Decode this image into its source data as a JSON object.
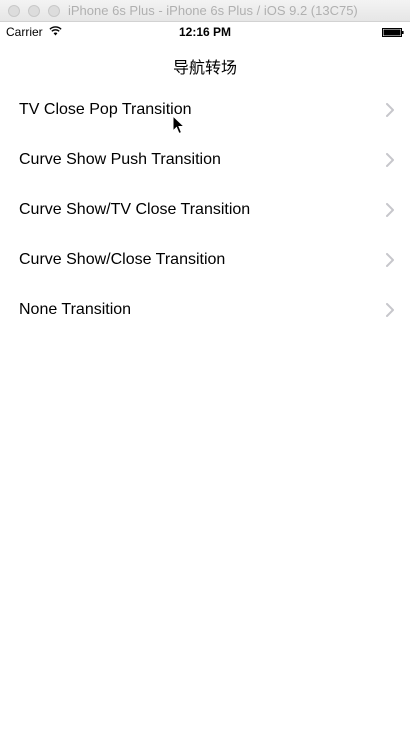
{
  "window": {
    "title": "iPhone 6s Plus - iPhone 6s Plus / iOS 9.2 (13C75)"
  },
  "status_bar": {
    "carrier": "Carrier",
    "time": "12:16 PM",
    "icons": [
      "wifi-icon",
      "battery-icon"
    ]
  },
  "nav_bar": {
    "title": "导航转场"
  },
  "table": {
    "rows": [
      {
        "label": "TV Close Pop Transition",
        "accessory": "chevron-right-icon"
      },
      {
        "label": "Curve Show Push Transition",
        "accessory": "chevron-right-icon"
      },
      {
        "label": "Curve Show/TV Close Transition",
        "accessory": "chevron-right-icon"
      },
      {
        "label": "Curve Show/Close Transition",
        "accessory": "chevron-right-icon"
      },
      {
        "label": "None Transition",
        "accessory": "chevron-right-icon"
      }
    ]
  },
  "colors": {
    "chevron": "#c7c7cc",
    "text": "#000000",
    "background": "#ffffff"
  }
}
